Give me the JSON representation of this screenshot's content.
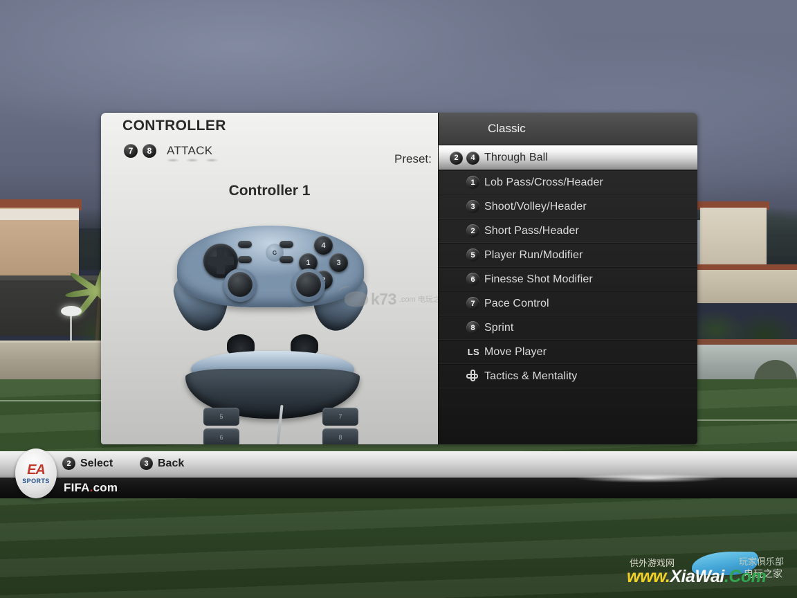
{
  "panel": {
    "title": "CONTROLLER",
    "section": {
      "badges": [
        "7",
        "8"
      ],
      "label": "ATTACK"
    },
    "controller_name": "Controller 1",
    "preset_label": "Preset:"
  },
  "preset": {
    "value": "Classic"
  },
  "bindings": [
    {
      "badges": [
        "2",
        "4"
      ],
      "label": "Through Ball",
      "selected": true,
      "icon": null
    },
    {
      "badges": [
        "1"
      ],
      "label": "Lob Pass/Cross/Header",
      "selected": false,
      "icon": null
    },
    {
      "badges": [
        "3"
      ],
      "label": "Shoot/Volley/Header",
      "selected": false,
      "icon": null
    },
    {
      "badges": [
        "2"
      ],
      "label": "Short Pass/Header",
      "selected": false,
      "icon": null
    },
    {
      "badges": [
        "5"
      ],
      "label": "Player Run/Modifier",
      "selected": false,
      "icon": null
    },
    {
      "badges": [
        "6"
      ],
      "label": "Finesse Shot Modifier",
      "selected": false,
      "icon": null
    },
    {
      "badges": [
        "7"
      ],
      "label": "Pace Control",
      "selected": false,
      "icon": null
    },
    {
      "badges": [
        "8"
      ],
      "label": "Sprint",
      "selected": false,
      "icon": null
    },
    {
      "badges": [],
      "label": "Move Player",
      "selected": false,
      "icon": "left-stick",
      "icon_text": "LS"
    },
    {
      "badges": [],
      "label": "Tactics & Mentality",
      "selected": false,
      "icon": "dpad"
    }
  ],
  "gamepad": {
    "face_buttons": [
      "1",
      "2",
      "3",
      "4"
    ],
    "brand": "Logitech",
    "shoulder_buttons": [
      "5",
      "6",
      "7",
      "8"
    ]
  },
  "footer": {
    "logo_mark": "EA",
    "logo_sub": "SPORTS",
    "hints": [
      {
        "badge": "2",
        "label": "Select"
      },
      {
        "badge": "3",
        "label": "Back"
      }
    ],
    "site": "FIFA",
    "site_dot": ".",
    "site_tld": "com"
  },
  "watermarks": {
    "center": {
      "text": "k73",
      "sub": ".com 电玩之"
    },
    "bottom_right": {
      "cn_top_left": "供外游戏网",
      "cn_top_right": "玩家俱乐部",
      "cn_mid_right": "电玩之家",
      "part1": "www.",
      "part2": "XiaWai",
      "part3": ".Com"
    }
  },
  "colors": {
    "panel_light": "#e9e9e7",
    "list_dark": "#252525",
    "selected_highlight": "#ffffff",
    "badge_dark": "#1a1a1a",
    "pitch_green": "#38522d",
    "sky": "#6c7389"
  }
}
